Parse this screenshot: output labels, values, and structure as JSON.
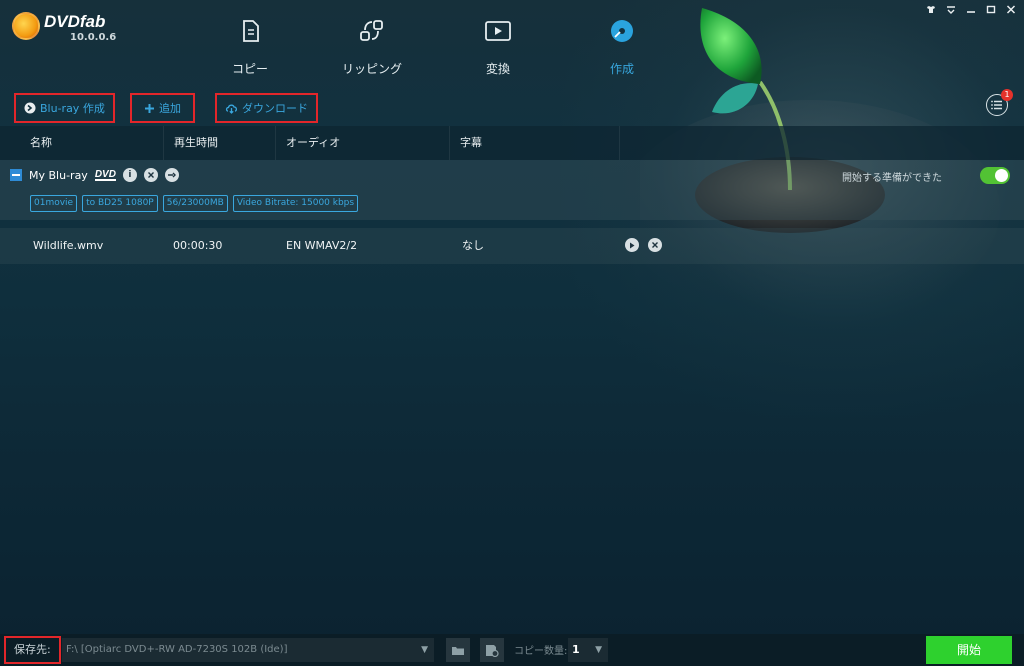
{
  "app": {
    "name": "DVDfab",
    "version": "10.0.0.6"
  },
  "nav": {
    "tabs": [
      {
        "label": "コピー",
        "icon": "copy-icon"
      },
      {
        "label": "リッピング",
        "icon": "ripper-icon"
      },
      {
        "label": "変換",
        "icon": "video-convert-icon"
      },
      {
        "label": "作成",
        "icon": "disc-create-icon",
        "active": true
      }
    ]
  },
  "toolbar": {
    "create_label": "Blu-ray 作成",
    "add_label": "追加",
    "download_label": "ダウンロード",
    "queue_badge": "1"
  },
  "columns": [
    "名称",
    "再生時間",
    "オーディオ",
    "字幕"
  ],
  "group": {
    "title": "My Blu-ray",
    "format_logo": "DVD",
    "tags": [
      "01movie",
      "to BD25 1080P",
      "56/23000MB",
      "Video Bitrate: 15000 kbps"
    ],
    "ready_text": "開始する準備ができた",
    "ready_on": true
  },
  "file": {
    "name": "Wildlife.wmv",
    "duration": "00:00:30",
    "audio": "EN  WMAV2/2",
    "subtitle": "なし"
  },
  "bottom": {
    "save_label": "保存先:",
    "save_path": "F:\\ [Optiarc DVD+-RW AD-7230S 102B (Ide)]",
    "copies_label": "コピー数量:",
    "copies_value": "1",
    "start_label": "開始"
  },
  "colors": {
    "accent": "#3aa7de",
    "highlight_box": "#e3262a",
    "start_green": "#2ed12e",
    "toggle_green": "#52c234"
  }
}
